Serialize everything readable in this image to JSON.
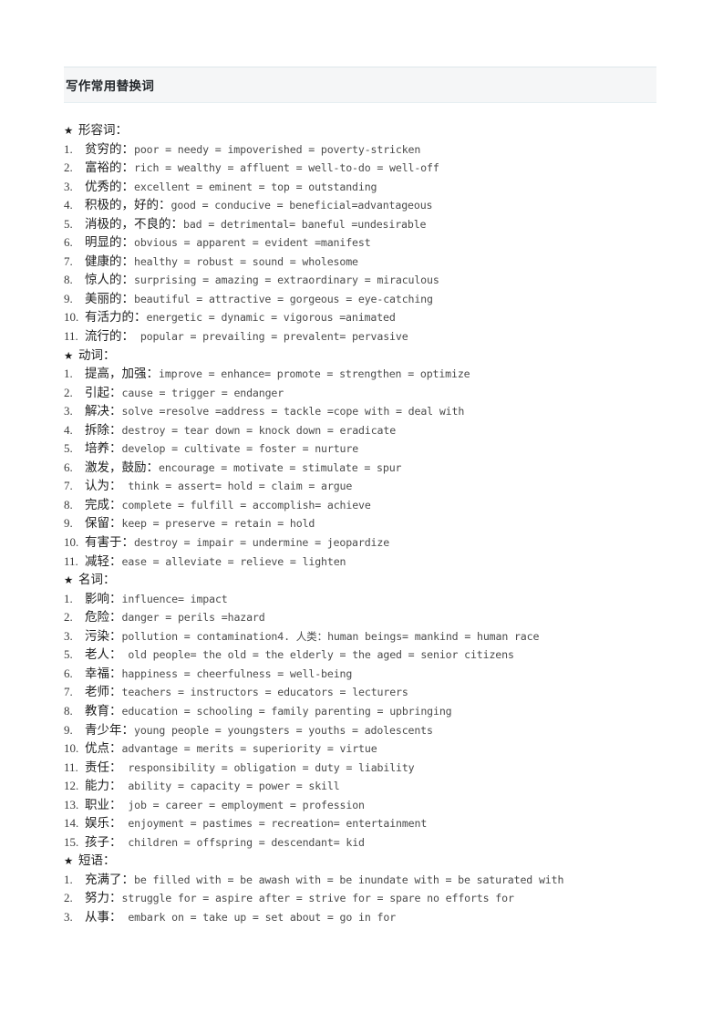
{
  "document": {
    "title": "写作常用替换词"
  },
  "sections": [
    {
      "bullet": "★",
      "heading": "形容词：",
      "items": [
        {
          "num": "1.",
          "cn": "贫穷的：",
          "en": "poor = needy = impoverished = poverty-stricken"
        },
        {
          "num": "2.",
          "cn": "富裕的：",
          "en": "rich = wealthy = affluent = well-to-do = well-off"
        },
        {
          "num": "3.",
          "cn": "优秀的：",
          "en": "excellent = eminent = top = outstanding"
        },
        {
          "num": "4.",
          "cn": "积极的，好的：",
          "en": "good = conducive = beneficial=advantageous"
        },
        {
          "num": "5.",
          "cn": "消极的，不良的：",
          "en": "bad = detrimental= baneful =undesirable"
        },
        {
          "num": "6.",
          "cn": "明显的：",
          "en": "obvious = apparent = evident =manifest"
        },
        {
          "num": "7.",
          "cn": "健康的：",
          "en": "healthy = robust = sound = wholesome"
        },
        {
          "num": "8.",
          "cn": "惊人的：",
          "en": "surprising = amazing = extraordinary = miraculous"
        },
        {
          "num": "9.",
          "cn": "美丽的：",
          "en": "beautiful = attractive = gorgeous = eye-catching"
        },
        {
          "num": "10.",
          "cn": "有活力的：",
          "en": "energetic = dynamic = vigorous =animated"
        },
        {
          "num": "11.",
          "cn": "流行的：",
          "en": " popular = prevailing = prevalent= pervasive"
        }
      ]
    },
    {
      "bullet": "★",
      "heading": "动词：",
      "items": [
        {
          "num": "1.",
          "cn": "提高，加强：",
          "en": "improve = enhance= promote = strengthen = optimize"
        },
        {
          "num": "2.",
          "cn": "引起：",
          "en": "cause = trigger = endanger"
        },
        {
          "num": "3.",
          "cn": "解决：",
          "en": "solve =resolve =address = tackle =cope with = deal with"
        },
        {
          "num": "4.",
          "cn": "拆除：",
          "en": "destroy = tear down = knock down = eradicate"
        },
        {
          "num": "5.",
          "cn": "培养：",
          "en": "develop = cultivate = foster = nurture"
        },
        {
          "num": "6.",
          "cn": "激发，鼓励：",
          "en": "encourage = motivate = stimulate = spur"
        },
        {
          "num": "7.",
          "cn": "认为：",
          "en": " think = assert= hold = claim = argue"
        },
        {
          "num": "8.",
          "cn": "完成：",
          "en": "complete = fulfill = accomplish= achieve"
        },
        {
          "num": "9.",
          "cn": "保留：",
          "en": "keep = preserve = retain = hold"
        },
        {
          "num": "10.",
          "cn": "有害于：",
          "en": "destroy = impair = undermine = jeopardize"
        },
        {
          "num": "11.",
          "cn": "减轻：",
          "en": "ease = alleviate = relieve = lighten"
        }
      ]
    },
    {
      "bullet": "★",
      "heading": "名词：",
      "items": [
        {
          "num": "1.",
          "cn": "影响：",
          "en": "influence= impact"
        },
        {
          "num": "2.",
          "cn": "危险：",
          "en": "danger = perils =hazard"
        },
        {
          "num": "3.",
          "cn": "污染：",
          "en": "pollution = contamination4. 人类：human beings= mankind = human race"
        },
        {
          "num": "5.",
          "cn": "老人：",
          "en": " old people= the old = the elderly = the aged = senior citizens"
        },
        {
          "num": "6.",
          "cn": "幸福：",
          "en": "happiness = cheerfulness = well-being"
        },
        {
          "num": "7.",
          "cn": "老师：",
          "en": "teachers = instructors = educators = lecturers"
        },
        {
          "num": "8.",
          "cn": "教育：",
          "en": "education = schooling = family parenting = upbringing"
        },
        {
          "num": "9.",
          "cn": "青少年：",
          "en": "young people = youngsters = youths = adolescents"
        },
        {
          "num": "10.",
          "cn": "优点：",
          "en": "advantage = merits = superiority = virtue"
        },
        {
          "num": "11.",
          "cn": "责任：",
          "en": " responsibility = obligation = duty = liability"
        },
        {
          "num": "12.",
          "cn": "能力：",
          "en": " ability = capacity = power = skill"
        },
        {
          "num": "13.",
          "cn": "职业：",
          "en": " job = career = employment = profession"
        },
        {
          "num": "14.",
          "cn": "娱乐：",
          "en": " enjoyment = pastimes = recreation= entertainment"
        },
        {
          "num": "15.",
          "cn": "孩子：",
          "en": " children = offspring = descendant= kid"
        }
      ]
    },
    {
      "bullet": "★",
      "heading": "短语：",
      "items": [
        {
          "num": "1.",
          "cn": "充满了：",
          "en": "be filled with = be awash with = be inundate with = be saturated with"
        },
        {
          "num": "2.",
          "cn": "努力：",
          "en": "struggle for = aspire after = strive for = spare no efforts for"
        },
        {
          "num": "3.",
          "cn": "从事：",
          "en": " embark on = take up = set about = go in for"
        }
      ]
    }
  ]
}
